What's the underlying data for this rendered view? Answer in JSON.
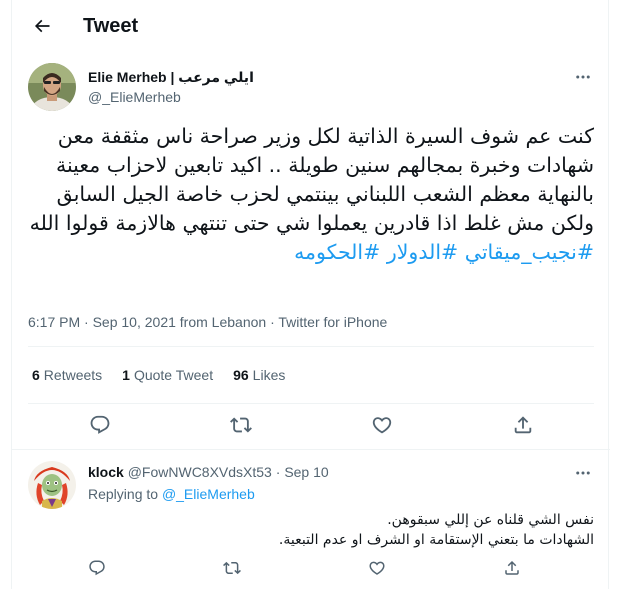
{
  "header": {
    "title": "Tweet",
    "back_icon": "arrow-left-icon"
  },
  "tweet": {
    "author_name": "Elie Merheb | ايلي مرعب",
    "author_handle": "@_ElieMerheb",
    "text": "كنت عم شوف السيرة الذاتية لكل وزير صراحة ناس مثقفة معن شهادات وخبرة بمجالهم سنين طويلة .. اكيد تابعين لاحزاب معينة بالنهاية معظم الشعب اللبناني بينتمي لحزب خاصة الجيل السابق ولكن مش غلط اذا قادرين يعملوا شي حتى تنتهي هالازمة قولوا الله",
    "hashtags": [
      "#نجيب_ميقاتي",
      "#الدولار",
      "#الحكومه"
    ],
    "time": "6:17 PM",
    "date": "Sep 10, 2021",
    "location": "from Lebanon",
    "client": "Twitter for iPhone",
    "separator": "·",
    "stats": {
      "retweets_count": "6",
      "retweets_label": "Retweets",
      "quotes_count": "1",
      "quotes_label": "Quote Tweet",
      "likes_count": "96",
      "likes_label": "Likes"
    }
  },
  "reply": {
    "author_name": "klock",
    "author_handle": "@FowNWC8XVdsXt53",
    "separator": "·",
    "date": "Sep 10",
    "replying_label": "Replying to",
    "replying_handle": "@_ElieMerheb",
    "line1": "نفس الشي قلناه عن إللي سبقوهن.",
    "line2": "الشهادات ما بتعني الإستقامة او الشرف او عدم التبعية."
  },
  "colors": {
    "accent": "#1d9bf0",
    "secondary_text": "#536471",
    "divider": "#eff3f4"
  }
}
